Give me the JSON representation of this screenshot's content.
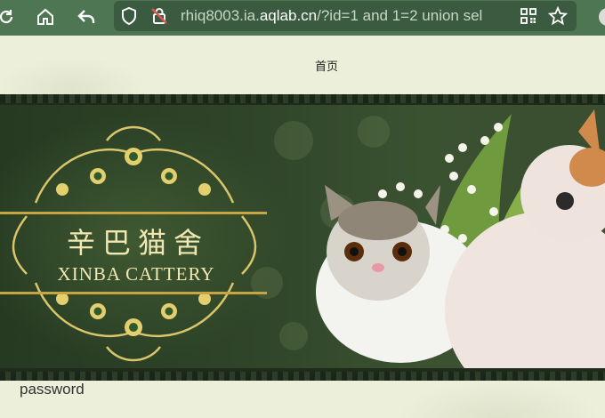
{
  "browser": {
    "url_plain_prefix": "rhiq8003.ia.",
    "url_domain": "aqlab.cn",
    "url_rest": "/?id=1 and 1=2 union sel"
  },
  "page": {
    "nav_home": "首页",
    "banner_title": "辛巴猫舍",
    "banner_subtitle": "XINBA CATTERY",
    "password_label": "password"
  },
  "icons": {
    "reload": "reload-icon",
    "home": "home-icon",
    "back": "back-icon",
    "shield": "shield-icon",
    "insecure": "insecure-lock-icon",
    "qr": "qr-code-icon",
    "favorite": "star-icon",
    "profile": "profile-icon"
  },
  "colors": {
    "toolbar": "#4f7653",
    "page_bg": "#ecefd9",
    "banner_dark": "#263a22",
    "logo_gold": "#f1e7b3"
  }
}
